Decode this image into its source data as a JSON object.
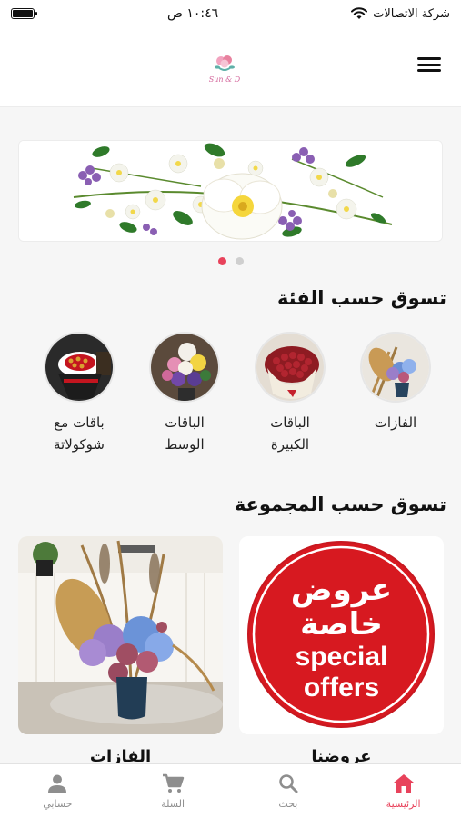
{
  "status_bar": {
    "carrier": "شركة الاتصالات",
    "time": "١٠:٤٦ ص"
  },
  "header": {
    "logo_text": "Sun & D"
  },
  "banner": {
    "slides": 2,
    "active_slide": 1
  },
  "categories_section": {
    "title": "تسوق حسب الفئة",
    "items": [
      {
        "label": "الفازات",
        "icon": "vase-bouquet-image"
      },
      {
        "label": "الباقات\nالكبيرة",
        "icon": "large-red-roses-image"
      },
      {
        "label": "الباقات\nالوسط",
        "icon": "medium-bouquet-image"
      },
      {
        "label": "باقات مع\nشوكولاتة",
        "icon": "chocolate-bouquet-image"
      }
    ]
  },
  "collections_section": {
    "title": "تسوق حسب المجموعة",
    "items": [
      {
        "label": "عروضنا",
        "badge_arabic_line1": "عروض",
        "badge_arabic_line2": "خاصة",
        "badge_english_line1": "special",
        "badge_english_line2": "offers"
      },
      {
        "label": "الفازات"
      }
    ]
  },
  "bottom_nav": {
    "items": [
      {
        "label": "الرئيسية",
        "icon": "home-icon",
        "active": true
      },
      {
        "label": "بحث",
        "icon": "search-icon",
        "active": false
      },
      {
        "label": "السلة",
        "icon": "cart-icon",
        "active": false
      },
      {
        "label": "حسابي",
        "icon": "person-icon",
        "active": false
      }
    ]
  },
  "colors": {
    "accent": "#e8425b",
    "offer_red": "#d71920",
    "background": "#f6f6f6"
  }
}
